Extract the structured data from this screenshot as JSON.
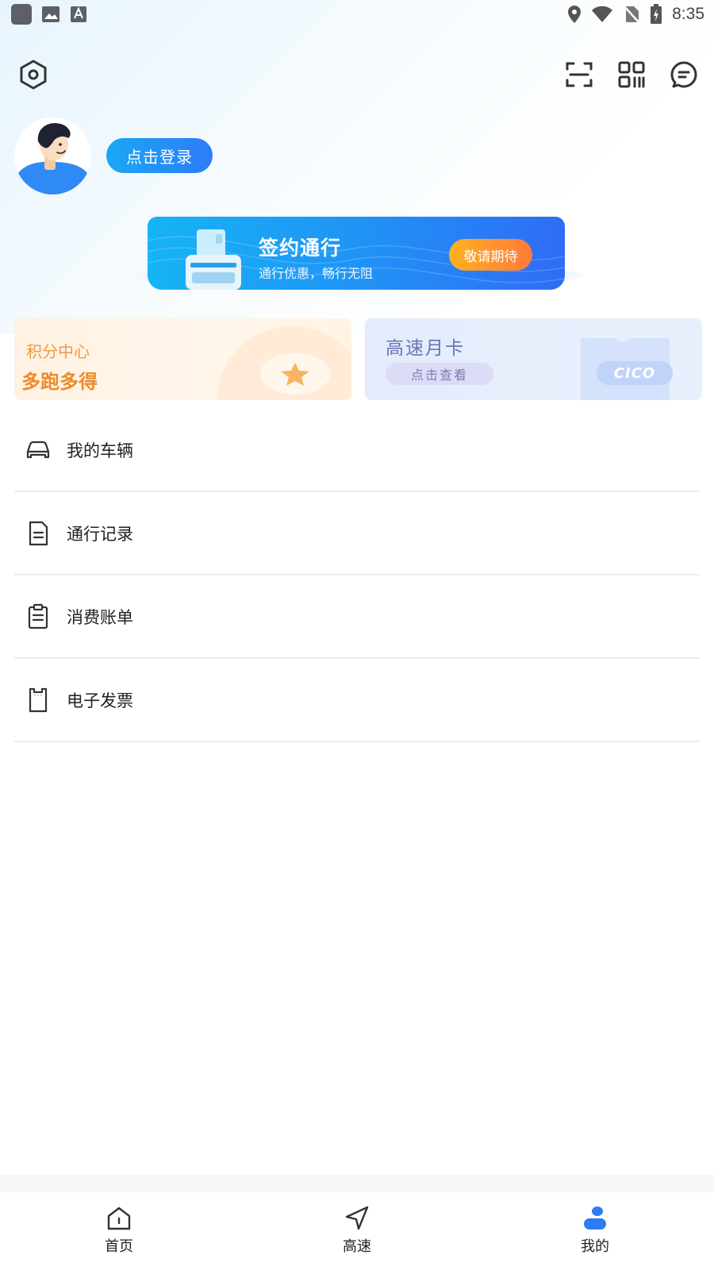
{
  "status_bar": {
    "time": "8:35"
  },
  "profile": {
    "login_label": "点击登录"
  },
  "sign_banner": {
    "title": "签约通行",
    "subtitle": "通行优惠，畅行无阻",
    "button_label": "敬请期待"
  },
  "cards": {
    "points": {
      "title": "积分中心",
      "subtitle": "多跑多得"
    },
    "monthly": {
      "title": "高速月卡",
      "button_label": "点击查看",
      "badge": "CICO"
    }
  },
  "menu": [
    {
      "label": "我的车辆",
      "icon": "car-icon"
    },
    {
      "label": "通行记录",
      "icon": "document-icon"
    },
    {
      "label": "消费账单",
      "icon": "clipboard-icon"
    },
    {
      "label": "电子发票",
      "icon": "invoice-icon"
    }
  ],
  "bottom_nav": [
    {
      "label": "首页",
      "icon": "home-icon"
    },
    {
      "label": "高速",
      "icon": "navigation-icon"
    },
    {
      "label": "我的",
      "icon": "profile-icon",
      "active": true
    }
  ],
  "colors": {
    "accent": "#2d7cf6",
    "points_orange": "#ee8a2a",
    "monthly_purple": "#6a74b6"
  }
}
